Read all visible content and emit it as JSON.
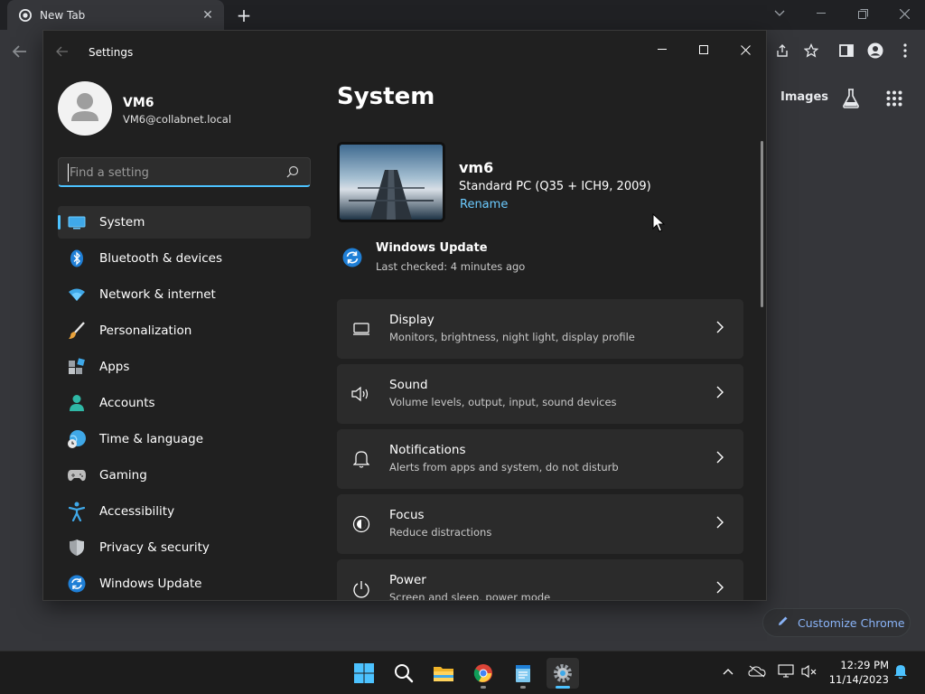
{
  "chrome": {
    "tab_title": "New Tab",
    "new_tab": "+",
    "images_link": "Images",
    "customize_label": "Customize Chrome"
  },
  "settings": {
    "window_title": "Settings",
    "profile": {
      "name": "VM6",
      "email": "VM6@collabnet.local"
    },
    "search": {
      "placeholder": "Find a setting"
    },
    "nav": [
      {
        "label": "System",
        "icon": "system-icon",
        "selected": true
      },
      {
        "label": "Bluetooth & devices",
        "icon": "bluetooth-icon"
      },
      {
        "label": "Network & internet",
        "icon": "wifi-icon"
      },
      {
        "label": "Personalization",
        "icon": "brush-icon"
      },
      {
        "label": "Apps",
        "icon": "apps-icon"
      },
      {
        "label": "Accounts",
        "icon": "accounts-icon"
      },
      {
        "label": "Time & language",
        "icon": "globe-clock-icon"
      },
      {
        "label": "Gaming",
        "icon": "gamepad-icon"
      },
      {
        "label": "Accessibility",
        "icon": "accessibility-icon"
      },
      {
        "label": "Privacy & security",
        "icon": "shield-icon"
      },
      {
        "label": "Windows Update",
        "icon": "windows-update-icon"
      }
    ],
    "main": {
      "title": "System",
      "device": {
        "name": "vm6",
        "model": "Standard PC (Q35 + ICH9, 2009)",
        "rename": "Rename"
      },
      "update": {
        "title": "Windows Update",
        "subtitle": "Last checked: 4 minutes ago"
      },
      "cards": [
        {
          "title": "Display",
          "subtitle": "Monitors, brightness, night light, display profile",
          "icon": "display-icon"
        },
        {
          "title": "Sound",
          "subtitle": "Volume levels, output, input, sound devices",
          "icon": "speaker-icon"
        },
        {
          "title": "Notifications",
          "subtitle": "Alerts from apps and system, do not disturb",
          "icon": "bell-icon"
        },
        {
          "title": "Focus",
          "subtitle": "Reduce distractions",
          "icon": "focus-icon"
        },
        {
          "title": "Power",
          "subtitle": "Screen and sleep, power mode",
          "icon": "power-icon"
        }
      ]
    }
  },
  "taskbar": {
    "time": "12:29 PM",
    "date": "11/14/2023",
    "apps": [
      "start-icon",
      "search-icon",
      "file-explorer-icon",
      "chrome-icon",
      "notepad-icon",
      "settings-icon"
    ]
  },
  "colors": {
    "accent": "#4cc2ff",
    "link": "#6ccbff",
    "chrome_link": "#8ab4f8"
  }
}
